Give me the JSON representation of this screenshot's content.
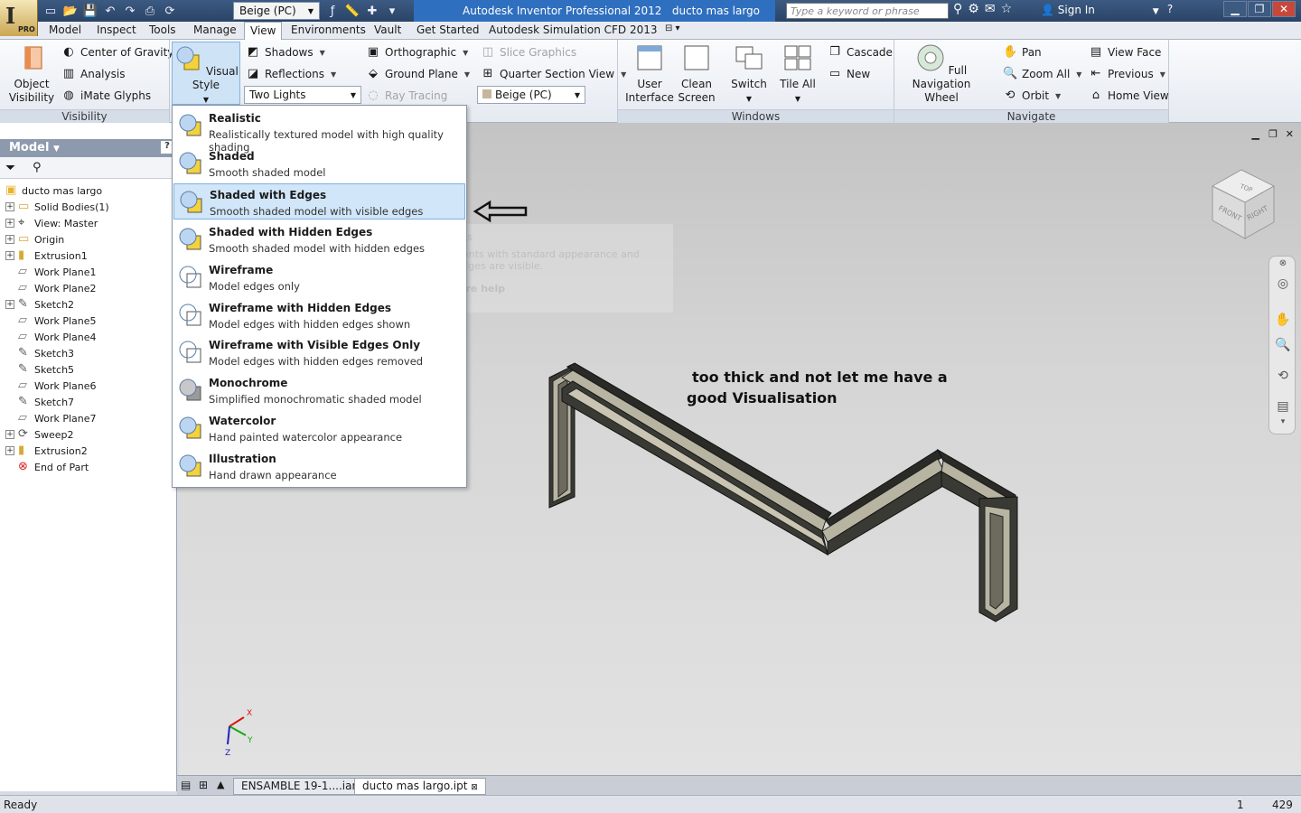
{
  "titlebar": {
    "app_title": "Autodesk Inventor Professional 2012",
    "doc_title": "ducto mas largo",
    "color_style": "Beige (PC)",
    "search_placeholder": "Type a keyword or phrase",
    "signin": "Sign In",
    "pro_label": "PRO",
    "logo_letter": "I"
  },
  "menu_tabs": [
    "Model",
    "Inspect",
    "Tools",
    "Manage",
    "View",
    "Environments",
    "Vault",
    "Get Started",
    "Autodesk Simulation CFD 2013"
  ],
  "active_tab": "View",
  "ribbon": {
    "visibility": {
      "object_visibility": "Object Visibility",
      "center_of_gravity": "Center of Gravity",
      "analysis": "Analysis",
      "imate_glyphs": "iMate Glyphs",
      "panel_label": "Visibility"
    },
    "appearance": {
      "visual_style": "Visual Style",
      "shadows": "Shadows",
      "reflections": "Reflections",
      "lighting": "Two Lights",
      "orthographic": "Orthographic",
      "ground_plane": "Ground Plane",
      "ray_tracing": "Ray Tracing",
      "slice_graphics": "Slice Graphics",
      "quarter_section": "Quarter Section View",
      "color_override": "Beige (PC)"
    },
    "windows": {
      "user_interface": "User Interface",
      "clean_screen": "Clean Screen",
      "switch": "Switch",
      "tile_all": "Tile All",
      "cascade": "Cascade",
      "new": "New",
      "panel_label": "Windows"
    },
    "navigate": {
      "full_nav_wheel": "Full Navigation Wheel",
      "pan": "Pan",
      "zoom_all": "Zoom All",
      "orbit": "Orbit",
      "view_face": "View Face",
      "previous": "Previous",
      "home_view": "Home View",
      "panel_label": "Navigate"
    }
  },
  "visual_styles": [
    {
      "name": "Realistic",
      "desc": "Realistically textured model with high quality shading"
    },
    {
      "name": "Shaded",
      "desc": "Smooth shaded model"
    },
    {
      "name": "Shaded with Edges",
      "desc": "Smooth shaded model with visible edges"
    },
    {
      "name": "Shaded with Hidden Edges",
      "desc": "Smooth shaded model with hidden edges"
    },
    {
      "name": "Wireframe",
      "desc": "Model edges only"
    },
    {
      "name": "Wireframe with Hidden Edges",
      "desc": "Model edges with hidden edges shown"
    },
    {
      "name": "Wireframe with Visible Edges Only",
      "desc": "Model edges with hidden edges removed"
    },
    {
      "name": "Monochrome",
      "desc": "Simplified monochromatic shaded model"
    },
    {
      "name": "Watercolor",
      "desc": "Hand painted watercolor appearance"
    },
    {
      "name": "Illustration",
      "desc": "Hand drawn appearance"
    }
  ],
  "selected_visual_style": "Shaded with Edges",
  "tooltip_ghost": {
    "title": "Shaded with edges",
    "body": "Displays components with standard appearance and external model edges are visible.",
    "help": "Press F1 for more help"
  },
  "browser": {
    "header": "Model",
    "tree": [
      {
        "label": "ducto mas largo",
        "icon": "part-icon",
        "expander": false,
        "indent": 0
      },
      {
        "label": "Solid Bodies(1)",
        "icon": "folder-icon",
        "expander": true,
        "indent": 1
      },
      {
        "label": "View: Master",
        "icon": "view-icon",
        "expander": true,
        "indent": 1
      },
      {
        "label": "Origin",
        "icon": "folder-icon",
        "expander": true,
        "indent": 1
      },
      {
        "label": "Extrusion1",
        "icon": "extrusion-icon",
        "expander": true,
        "indent": 1
      },
      {
        "label": "Work Plane1",
        "icon": "workplane-icon",
        "expander": false,
        "indent": 1
      },
      {
        "label": "Work Plane2",
        "icon": "workplane-icon",
        "expander": false,
        "indent": 1
      },
      {
        "label": "Sketch2",
        "icon": "sketch-icon",
        "expander": true,
        "indent": 1
      },
      {
        "label": "Work Plane5",
        "icon": "workplane-icon",
        "expander": false,
        "indent": 1
      },
      {
        "label": "Work Plane4",
        "icon": "workplane-icon",
        "expander": false,
        "indent": 1
      },
      {
        "label": "Sketch3",
        "icon": "sketch-icon",
        "expander": false,
        "indent": 1
      },
      {
        "label": "Sketch5",
        "icon": "sketch-icon",
        "expander": false,
        "indent": 1
      },
      {
        "label": "Work Plane6",
        "icon": "workplane-icon",
        "expander": false,
        "indent": 1
      },
      {
        "label": "Sketch7",
        "icon": "sketch-icon",
        "expander": false,
        "indent": 1
      },
      {
        "label": "Work Plane7",
        "icon": "workplane-icon",
        "expander": false,
        "indent": 1
      },
      {
        "label": "Sweep2",
        "icon": "sweep-icon",
        "expander": true,
        "indent": 1
      },
      {
        "label": "Extrusion2",
        "icon": "extrusion-icon",
        "expander": true,
        "indent": 1
      },
      {
        "label": "End of Part",
        "icon": "end-of-part-icon",
        "expander": false,
        "indent": 1
      }
    ]
  },
  "viewport": {
    "annotation_line1": "too thick and not let me have a",
    "annotation_line2": "good Visualisation",
    "viewcube": {
      "top": "TOP",
      "front": "FRONT",
      "right": "RIGHT"
    },
    "axis": {
      "x": "X",
      "y": "Y",
      "z": "Z"
    }
  },
  "doc_tabs": [
    {
      "label": "ENSAMBLE 19-1....iam",
      "active": false
    },
    {
      "label": "ducto mas largo.ipt",
      "active": true
    }
  ],
  "status": {
    "text": "Ready",
    "count1": "1",
    "count2": "429"
  },
  "colors": {
    "selection_bg": "#d1e6f8",
    "title_blue": "#2f6fbf",
    "model_face": "#b8b4a2"
  }
}
